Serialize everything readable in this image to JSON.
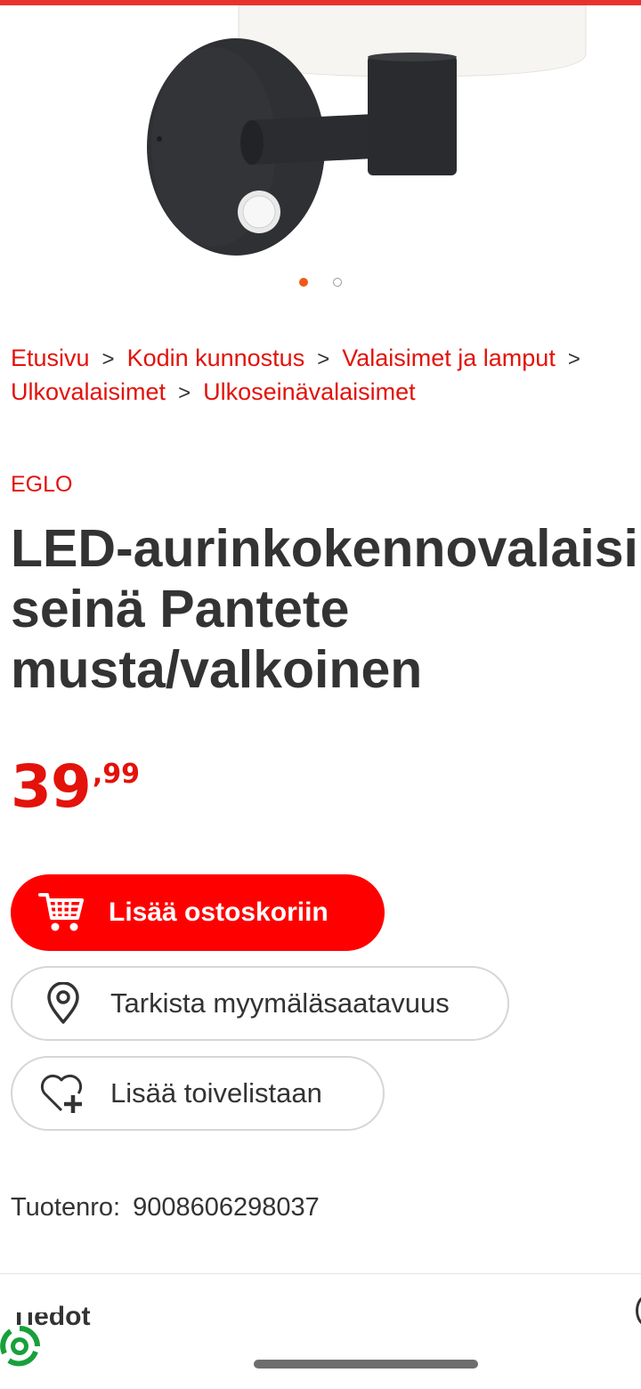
{
  "gallery": {
    "total_images": 2,
    "active_index": 0
  },
  "breadcrumb": {
    "items": [
      "Etusivu",
      "Kodin kunnostus",
      "Valaisimet ja lamput",
      "Ulkovalaisimet",
      "Ulkoseinävalaisimet"
    ],
    "separator": ">"
  },
  "product": {
    "brand": "EGLO",
    "title": "LED-aurinkokennovalaisin seinä Pantete musta/valkoinen",
    "price": {
      "main": "39",
      "cents": ",99"
    },
    "sku_label": "Tuotenro:",
    "sku": "9008606298037"
  },
  "actions": {
    "add_to_cart": "Lisää ostoskoriin",
    "check_store": "Tarkista myymäläsaatavuus",
    "add_to_wishlist": "Lisää toivelistaan"
  },
  "details": {
    "title": "Tiedot"
  },
  "icons": {
    "cart": "shopping-cart-icon",
    "location": "location-pin-icon",
    "wishlist": "heart-plus-icon",
    "eco": "eco-recycle-icon"
  },
  "colors": {
    "brand_red": "#e3120b",
    "button_red": "#ff0000",
    "accent_dot": "#f05a1a",
    "text": "#333333"
  }
}
